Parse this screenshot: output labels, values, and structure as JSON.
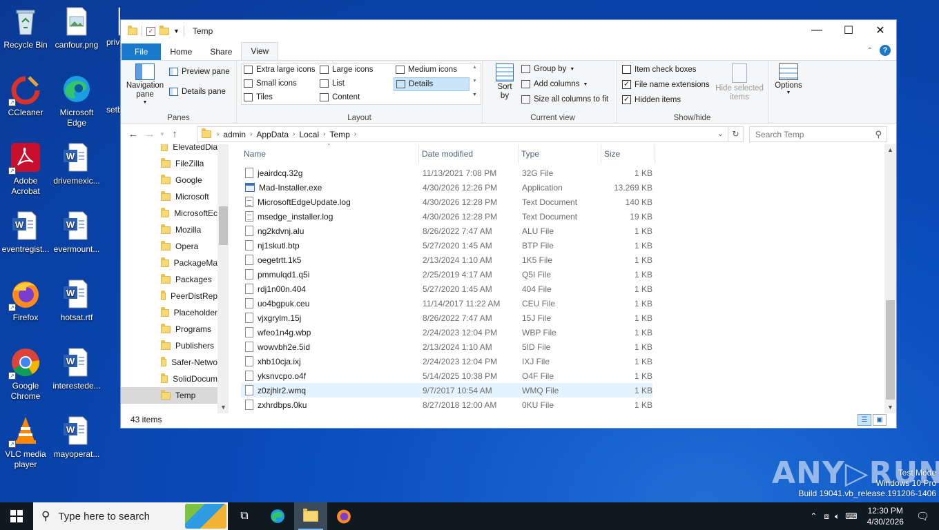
{
  "desktop": {
    "icons": [
      {
        "label": "Recycle Bin"
      },
      {
        "label": "canfour.png"
      },
      {
        "label": "priv"
      },
      {
        "label": "CCleaner"
      },
      {
        "label": "Microsoft Edge"
      },
      {
        "label": "setb"
      },
      {
        "label": "Adobe Acrobat"
      },
      {
        "label": "drivemexic..."
      },
      {
        "label": "eventregist..."
      },
      {
        "label": "evermount..."
      },
      {
        "label": "Firefox"
      },
      {
        "label": "hotsat.rtf"
      },
      {
        "label": "Google Chrome"
      },
      {
        "label": "interestede..."
      },
      {
        "label": "VLC media player"
      },
      {
        "label": "mayoperat..."
      }
    ]
  },
  "window": {
    "title": "Temp",
    "tabs": [
      "File",
      "Home",
      "Share",
      "View"
    ],
    "ribbon": {
      "panes": {
        "navigation_pane": "Navigation pane",
        "preview_pane": "Preview pane",
        "details_pane": "Details pane",
        "label": "Panes"
      },
      "layout": {
        "items": [
          "Extra large icons",
          "Large icons",
          "Medium icons",
          "Small icons",
          "List",
          "Details",
          "Tiles",
          "Content"
        ],
        "selected": "Details",
        "label": "Layout"
      },
      "current_view": {
        "sort_by": "Sort by",
        "group_by": "Group by",
        "add_columns": "Add columns",
        "size_all": "Size all columns to fit",
        "label": "Current view"
      },
      "show_hide": {
        "item_check_boxes": "Item check boxes",
        "file_name_extensions": "File name extensions",
        "hidden_items": "Hidden items",
        "item_check_boxes_checked": false,
        "file_name_extensions_checked": true,
        "hidden_items_checked": true,
        "hide_selected": "Hide selected items",
        "label": "Show/hide"
      },
      "options": "Options"
    },
    "address": {
      "crumbs": [
        "admin",
        "AppData",
        "Local",
        "Temp"
      ],
      "search_placeholder": "Search Temp"
    },
    "nav_items": [
      "ElevatedDia",
      "FileZilla",
      "Google",
      "Microsoft",
      "MicrosoftEc",
      "Mozilla",
      "Opera",
      "PackageMa",
      "Packages",
      "PeerDistRep",
      "Placeholder",
      "Programs",
      "Publishers",
      "Safer-Netwo",
      "SolidDocum",
      "Temp"
    ],
    "nav_selected": "Temp",
    "columns": {
      "name": "Name",
      "date": "Date modified",
      "type": "Type",
      "size": "Size"
    },
    "files": [
      {
        "name": "jeairdcq.32g",
        "date": "11/13/2021 7:08 PM",
        "type": "32G File",
        "size": "1 KB",
        "icon": "generic"
      },
      {
        "name": "Mad-Installer.exe",
        "date": "4/30/2026 12:26 PM",
        "type": "Application",
        "size": "13,269 KB",
        "icon": "exe"
      },
      {
        "name": "MicrosoftEdgeUpdate.log",
        "date": "4/30/2026 12:28 PM",
        "type": "Text Document",
        "size": "140 KB",
        "icon": "doc"
      },
      {
        "name": "msedge_installer.log",
        "date": "4/30/2026 12:28 PM",
        "type": "Text Document",
        "size": "19 KB",
        "icon": "doc"
      },
      {
        "name": "ng2kdvnj.alu",
        "date": "8/26/2022 7:47 AM",
        "type": "ALU File",
        "size": "1 KB",
        "icon": "generic"
      },
      {
        "name": "nj1skutl.btp",
        "date": "5/27/2020 1:45 AM",
        "type": "BTP File",
        "size": "1 KB",
        "icon": "generic"
      },
      {
        "name": "oegetrtt.1k5",
        "date": "2/13/2024 1:10 AM",
        "type": "1K5 File",
        "size": "1 KB",
        "icon": "generic"
      },
      {
        "name": "pmmulqd1.q5i",
        "date": "2/25/2019 4:17 AM",
        "type": "Q5I File",
        "size": "1 KB",
        "icon": "generic"
      },
      {
        "name": "rdj1n00n.404",
        "date": "5/27/2020 1:45 AM",
        "type": "404 File",
        "size": "1 KB",
        "icon": "generic"
      },
      {
        "name": "uo4bgpuk.ceu",
        "date": "11/14/2017 11:22 AM",
        "type": "CEU File",
        "size": "1 KB",
        "icon": "generic"
      },
      {
        "name": "vjxgrylm.15j",
        "date": "8/26/2022 7:47 AM",
        "type": "15J File",
        "size": "1 KB",
        "icon": "generic"
      },
      {
        "name": "wfeo1n4g.wbp",
        "date": "2/24/2023 12:04 PM",
        "type": "WBP File",
        "size": "1 KB",
        "icon": "generic"
      },
      {
        "name": "wowvbh2e.5id",
        "date": "2/13/2024 1:10 AM",
        "type": "5ID File",
        "size": "1 KB",
        "icon": "generic"
      },
      {
        "name": "xhb10cja.ixj",
        "date": "2/24/2023 12:04 PM",
        "type": "IXJ File",
        "size": "1 KB",
        "icon": "generic"
      },
      {
        "name": "yksnvcpo.o4f",
        "date": "5/14/2025 10:38 PM",
        "type": "O4F File",
        "size": "1 KB",
        "icon": "generic"
      },
      {
        "name": "z0zjhlr2.wmq",
        "date": "9/7/2017 10:54 AM",
        "type": "WMQ File",
        "size": "1 KB",
        "icon": "generic"
      },
      {
        "name": "zxhrdbps.0ku",
        "date": "8/27/2018 12:00 AM",
        "type": "0KU File",
        "size": "1 KB",
        "icon": "generic"
      }
    ],
    "highlighted_file": "z0zjhlr2.wmq",
    "status": "43 items"
  },
  "taskbar": {
    "search_placeholder": "Type here to search",
    "time": "12:30 PM",
    "date": "4/30/2026"
  },
  "watermark": {
    "line1": "Test Mode",
    "line2": "Windows 10 Pro",
    "line3": "Build 19041.vb_release.191206-1406",
    "brand": "ANY RUN"
  },
  "colors": {
    "accent": "#1979ca",
    "desktop": "#0b4fc0",
    "taskbar": "#101820"
  }
}
